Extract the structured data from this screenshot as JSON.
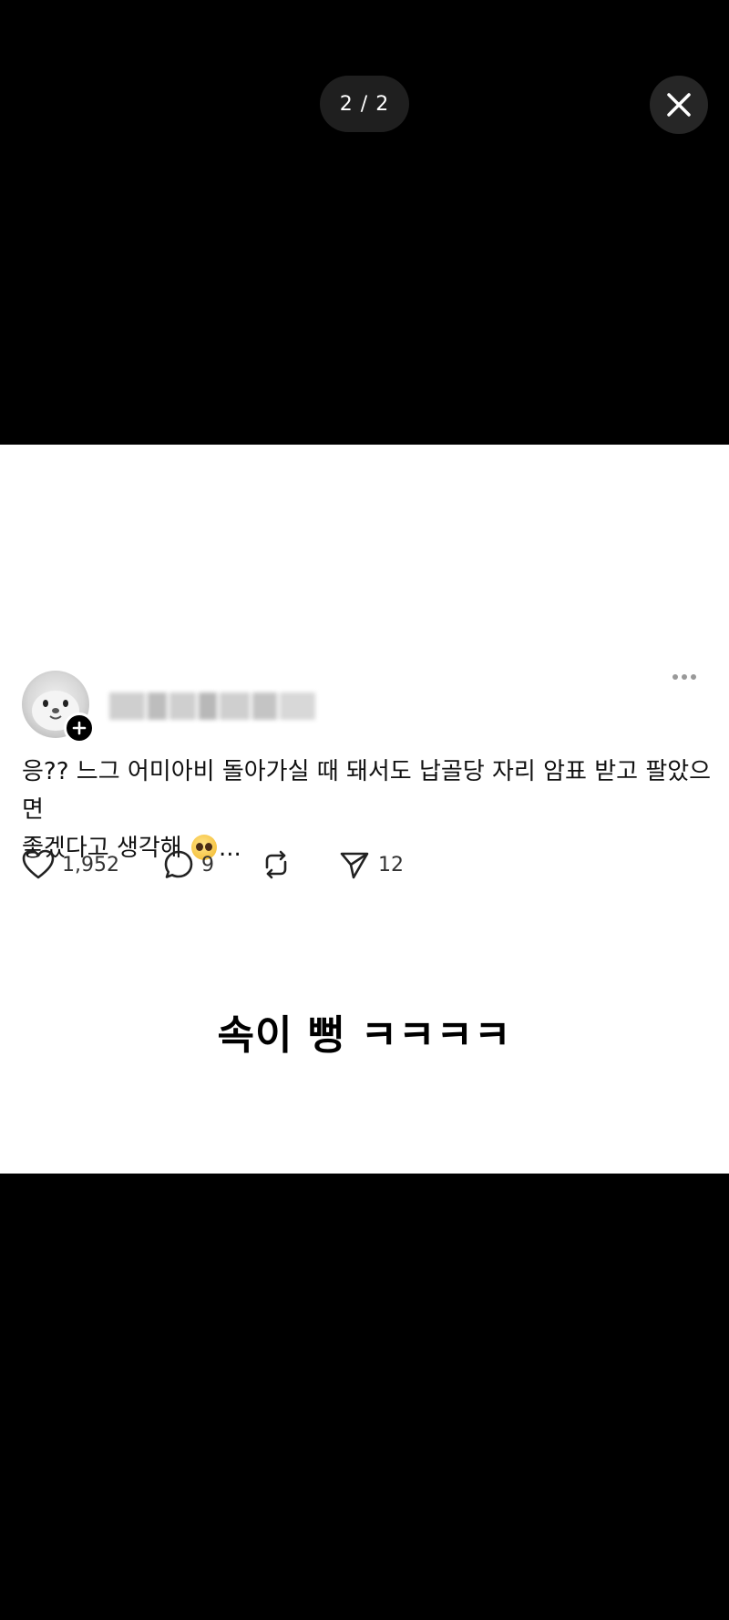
{
  "viewer": {
    "counter": "2 / 2",
    "close_icon": "close-icon"
  },
  "post": {
    "avatar_icon": "seal-avatar",
    "follow_icon": "plus-icon",
    "more_icon": "more-dots-icon",
    "text_line1": "응?? 느그 어미아비 돌아가실 때 돼서도 납골당 자리 암표 받고 팔았으면",
    "text_line2": "좋겠다고 생각해",
    "text_tail": "...",
    "emoji_icon": "pleading-face-emoji",
    "actions": {
      "likes": "1,952",
      "comments": "9",
      "shares": "12",
      "like_icon": "heart-icon",
      "comment_icon": "comment-icon",
      "repost_icon": "repost-icon",
      "share_icon": "send-icon"
    }
  },
  "caption": "속이 뻥 ㅋㅋㅋㅋ"
}
